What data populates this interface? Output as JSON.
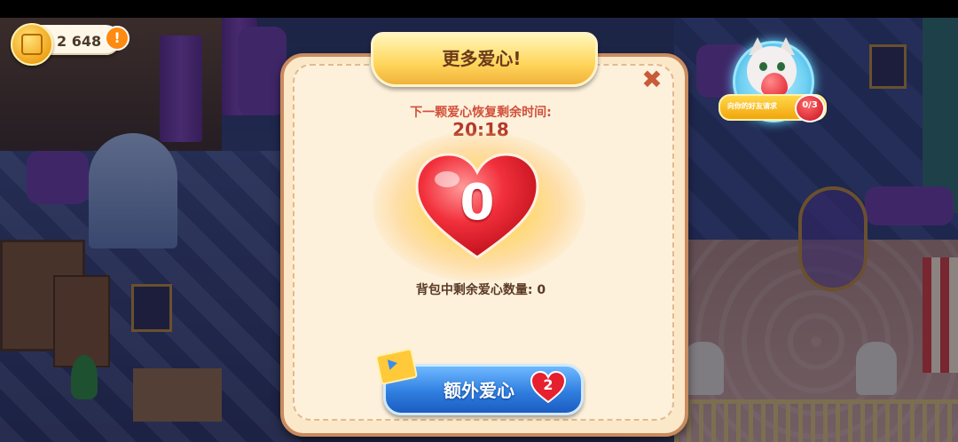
{
  "hud": {
    "coins": "2 648",
    "alert_symbol": "!"
  },
  "friend_request": {
    "label": "向你的好友请求",
    "count": "0/3"
  },
  "dialog": {
    "title": "更多爱心!",
    "recover_label": "下一颗爱心恢复剩余时间:",
    "timer": "20:18",
    "hearts": "0",
    "backpack_label": "背包中剩余爱心数量: 0",
    "extra_button_label": "额外爱心",
    "extra_button_count": "2"
  },
  "icons": [
    "coin-icon",
    "alert-icon",
    "cat-avatar-icon",
    "heart-icon",
    "close-icon",
    "video-clapper-icon"
  ],
  "colors": {
    "title_text": "#6b3a1a",
    "timer_text": "#b43a28",
    "heart_red": "#e01c2a",
    "button_blue": "#2f7fe0",
    "coin_gold": "#f0a51a"
  }
}
